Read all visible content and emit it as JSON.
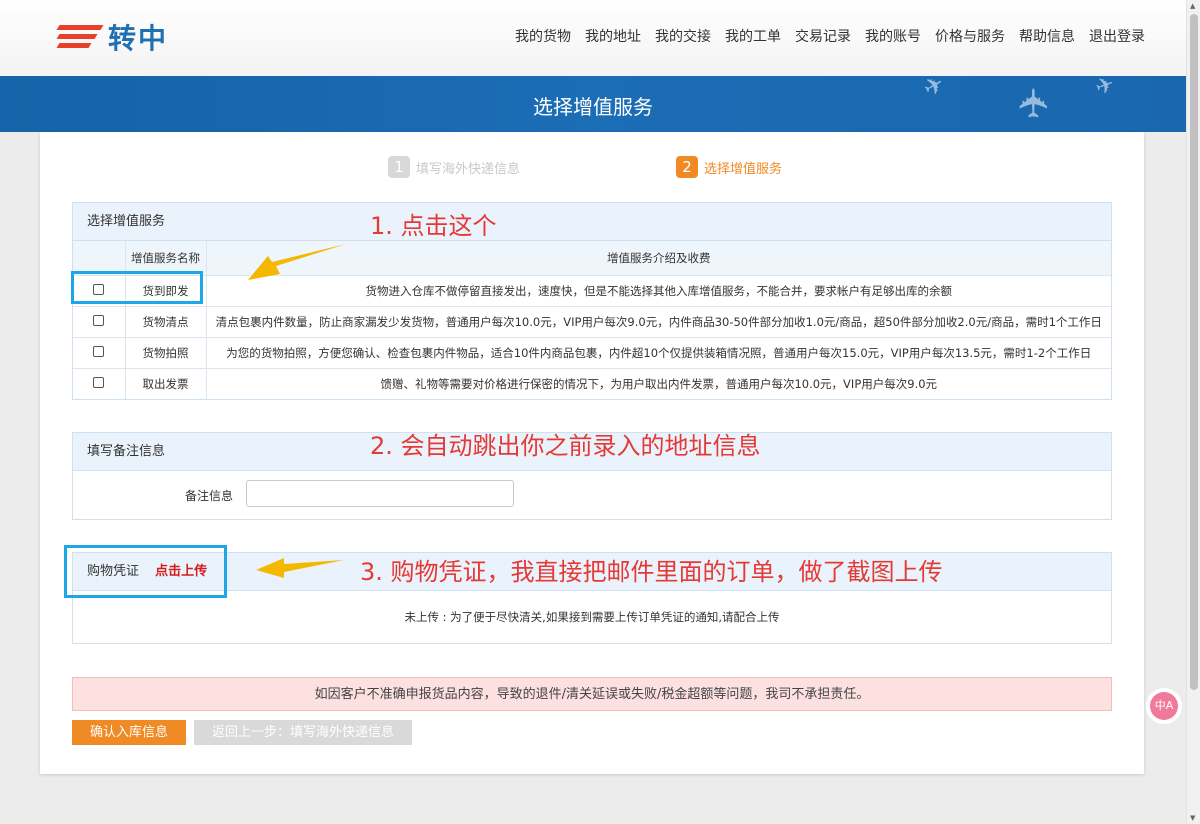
{
  "brand": {
    "name": "转中"
  },
  "nav": [
    "我的货物",
    "我的地址",
    "我的交接",
    "我的工单",
    "交易记录",
    "我的账号",
    "价格与服务",
    "帮助信息",
    "退出登录"
  ],
  "banner": {
    "title": "选择增值服务"
  },
  "steps": [
    {
      "num": "1",
      "label": "填写海外快递信息"
    },
    {
      "num": "2",
      "label": "选择增值服务"
    }
  ],
  "services": {
    "title": "选择增值服务",
    "columns": [
      "",
      "增值服务名称",
      "增值服务介绍及收费"
    ],
    "rows": [
      {
        "name": "货到即发",
        "desc": "货物进入仓库不做停留直接发出，速度快，但是不能选择其他入库增值服务，不能合并，要求帐户有足够出库的余额"
      },
      {
        "name": "货物清点",
        "desc": "清点包裹内件数量，防止商家漏发少发货物，普通用户每次10.0元，VIP用户每次9.0元，内件商品30-50件部分加收1.0元/商品，超50件部分加收2.0元/商品，需时1个工作日"
      },
      {
        "name": "货物拍照",
        "desc": "为您的货物拍照，方便您确认、检查包裹内件物品，适合10件内商品包裹，内件超10个仅提供装箱情况照，普通用户每次15.0元，VIP用户每次13.5元，需时1-2个工作日"
      },
      {
        "name": "取出发票",
        "desc": "馈赠、礼物等需要对价格进行保密的情况下，为用户取出内件发票，普通用户每次10.0元，VIP用户每次9.0元"
      }
    ]
  },
  "remark": {
    "title": "填写备注信息",
    "label": "备注信息",
    "value": ""
  },
  "voucher": {
    "title": "购物凭证",
    "upload_label": "点击上传",
    "status": "未上传 : 为了便于尽快清关,如果接到需要上传订单凭证的通知,请配合上传"
  },
  "warning": "如因客户不准确申报货品内容，导致的退件/清关延误或失败/税金超额等问题，我司不承担责任。",
  "buttons": {
    "confirm": "确认入库信息",
    "back": "返回上一步：填写海外快递信息"
  },
  "annotations": {
    "step1": "1. 点击这个",
    "step2": "2. 会自动跳出你之前录入的地址信息",
    "step3": "3. 购物凭证，我直接把邮件里面的订单，做了截图上传"
  },
  "float_button": {
    "label": "中A"
  },
  "colors": {
    "accent": "#f08a24",
    "banner": "#1563a8",
    "annotation": "#e53935",
    "highlight": "#1ea7e8"
  }
}
